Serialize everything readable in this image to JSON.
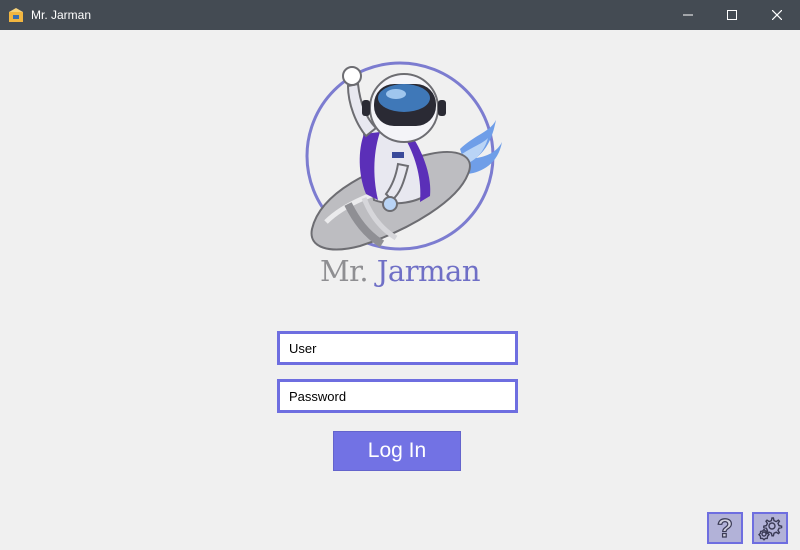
{
  "window": {
    "title": "Mr. Jarman",
    "icons": [
      "app-icon",
      "minimize-icon",
      "maximize-icon",
      "close-icon"
    ]
  },
  "logo": {
    "icon": "astronaut-riding-rocket-logo",
    "brand_word1": "Mr.",
    "brand_word2": "Jarman"
  },
  "form": {
    "user_placeholder": "User",
    "password_placeholder": "Password",
    "login_label": "Log In"
  },
  "tools": {
    "help_icon": "question-mark-icon",
    "settings_icon": "gear-icon"
  },
  "colors": {
    "titlebar": "#444b53",
    "accent": "#7272e4",
    "field_border": "#6e6ee0",
    "background": "#f0f0f0",
    "brand_gray": "#8f8f92",
    "brand_purple": "#6f6fc6"
  }
}
